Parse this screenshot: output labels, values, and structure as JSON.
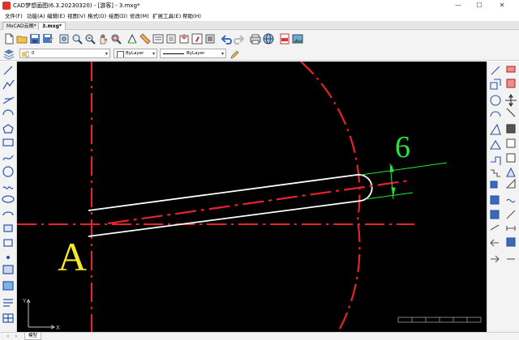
{
  "window": {
    "title": "CAD梦想画图(6.3.20230320) - [游客] - 3.mxg*",
    "minimize": "—",
    "maximize": "☐",
    "close": "✕"
  },
  "menu": {
    "items": [
      "文件(F)",
      "功能(A)",
      "编辑(E)",
      "视图(V)",
      "格式(O)",
      "绘图(D)",
      "修改(M)",
      "扩展工具(E)",
      "帮助(H)"
    ]
  },
  "tabs": {
    "cloud": "MxCAD云图*",
    "file": "3.mxg*"
  },
  "properties": {
    "layer_value": "0",
    "color_value": "ByLayer",
    "linetype_value": "ByLayer"
  },
  "drawing": {
    "label_a": "A",
    "dimension_value": "6",
    "axis_y": "Y",
    "axis_x": "X"
  },
  "bottom": {
    "model_tab": "模型"
  },
  "colors": {
    "canvas_bg": "#000000",
    "centerline": "#e8232b",
    "outline": "#ffffff",
    "dimension": "#22e838",
    "label": "#f5e82a",
    "axis": "#bfbfbf"
  },
  "icons": {
    "toolbar": [
      "new-file-icon",
      "open-folder-icon",
      "save-icon",
      "save-as-icon",
      "print-preview-icon",
      "zoom-window-icon",
      "zoom-realtime-icon",
      "pan-icon",
      "zoom-extents-icon",
      "zoom-previous-icon",
      "layer-manager-icon",
      "properties-icon",
      "block-icon",
      "insert-icon",
      "match-properties-icon",
      "text-style-icon",
      "undo-icon",
      "redo-icon",
      "plot-icon",
      "web-icon",
      "pdf-icon",
      "image-icon"
    ],
    "left": [
      "line-icon",
      "polyline-icon",
      "construction-line-icon",
      "arc-icon",
      "polygon-icon",
      "rectangle-icon",
      "spline-icon",
      "circle-icon",
      "revision-cloud-icon",
      "ellipse-icon",
      "ellipse-arc-icon",
      "insert-block-icon",
      "create-block-icon",
      "point-icon",
      "hatch-icon",
      "text-icon",
      "image-icon",
      "multiline-text-icon",
      "table-icon"
    ],
    "right": [
      "erase-icon",
      "copy-icon",
      "mirror-icon",
      "offset-icon",
      "array-icon",
      "move-icon",
      "rotate-icon",
      "scale-icon",
      "stretch-icon",
      "trim-icon",
      "extend-icon",
      "break-icon",
      "join-icon",
      "chamfer-icon",
      "fillet-icon",
      "explode-icon",
      "lengthen-icon",
      "align-icon",
      "3d-icon",
      "distance-icon"
    ]
  }
}
